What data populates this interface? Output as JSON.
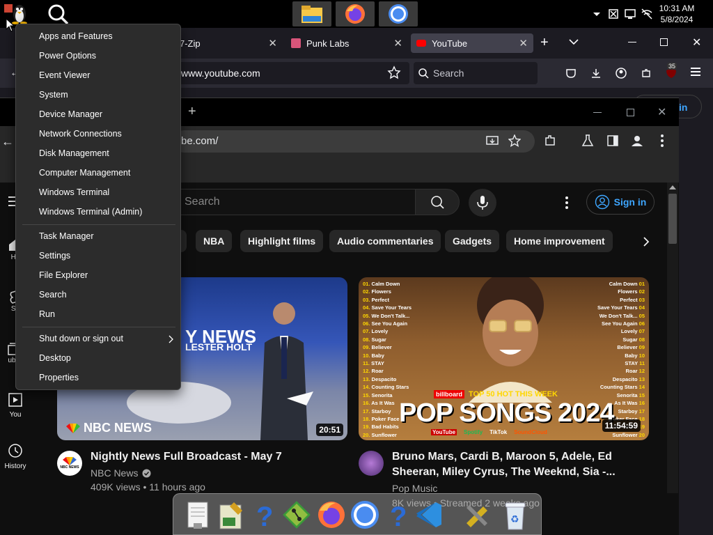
{
  "taskbar": {
    "clock_time": "10:31 AM",
    "clock_date": "5/8/2024",
    "pinned": [
      "file-explorer-icon",
      "firefox-icon",
      "chrome-icon"
    ]
  },
  "firefox": {
    "tabs": [
      {
        "label": "7-Zip"
      },
      {
        "label": "Punk Labs"
      },
      {
        "label": "YouTube"
      }
    ],
    "url": "www.youtube.com",
    "search_placeholder": "Search",
    "extensions_badge": "35",
    "signin_partial": "in"
  },
  "chrome": {
    "url": "be.com/"
  },
  "youtube": {
    "search_placeholder": "Search",
    "signin_label": "Sign in",
    "chips": [
      "NBA",
      "Highlight films",
      "Audio commentaries",
      "Gadgets",
      "Home improvement"
    ],
    "guide": [
      {
        "label": "Ho"
      },
      {
        "label": "Sh"
      },
      {
        "label": "ubsc"
      },
      {
        "label": "You"
      },
      {
        "label": "History"
      }
    ],
    "videos": [
      {
        "title": "Nightly News Full Broadcast - May 7",
        "channel": "NBC News",
        "meta": "409K views • 11 hours ago",
        "duration": "20:51",
        "thumb_text_1": "Y NEWS",
        "thumb_text_2": "LESTER HOLT",
        "thumb_logo": "NBC NEWS",
        "avatar_text": "NBC NEWS"
      },
      {
        "title_line1": "Bruno Mars, Cardi B, Maroon 5, Adele, Ed",
        "title_line2": "Sheeran, Miley Cyrus, The Weeknd, Sia -...",
        "channel": "Pop Music",
        "meta": "8K views • Streamed 2 weeks ago",
        "duration": "11:54:59",
        "thumb_banner": "TOP 50 HOT THIS WEEK",
        "thumb_brand": "billboard",
        "thumb_title": "POP SONGS 2024",
        "platforms": [
          "YouTube",
          "Spotify",
          "TikTok",
          "SoundCloud"
        ],
        "tracks": [
          "Calm Down",
          "Flowers",
          "Perfect",
          "Save Your Tears",
          "We Don't Talk...",
          "See You Again",
          "Lovely",
          "Sugar",
          "Believer",
          "Baby",
          "STAY",
          "Roar",
          "Despacito",
          "Counting Stars",
          "Senorita",
          "As It Was",
          "Starboy",
          "Poker Face",
          "Bad Habits",
          "Sunflower"
        ],
        "tracks_right": [
          "Calm Down",
          "Flowers",
          "Perfect",
          "Save Your Tears",
          "We Don't Talk...",
          "See You Again",
          "Lovely",
          "Sugar",
          "Believer",
          "Baby",
          "STAY",
          "Roar",
          "Despacito",
          "Counting Stars",
          "Senorita",
          "As It Was",
          "Starboy",
          "Poker Face",
          "Bad Habits",
          "Sunflower"
        ]
      }
    ]
  },
  "context_menu": {
    "group1": [
      "Apps and Features",
      "Power Options",
      "Event Viewer",
      "System",
      "Device Manager",
      "Network Connections",
      "Disk Management",
      "Computer Management",
      "Windows Terminal",
      "Windows Terminal (Admin)"
    ],
    "group2": [
      "Task Manager",
      "Settings",
      "File Explorer",
      "Search",
      "Run"
    ],
    "group3": [
      "Shut down or sign out",
      "Desktop",
      "Properties"
    ]
  },
  "dock": {
    "icons": [
      "text-editor-icon",
      "notes-icon",
      "help-icon",
      "git-icon",
      "firefox-icon",
      "chrome-icon",
      "help-icon",
      "vscode-icon",
      "tools-icon",
      "recycle-bin-icon"
    ]
  }
}
